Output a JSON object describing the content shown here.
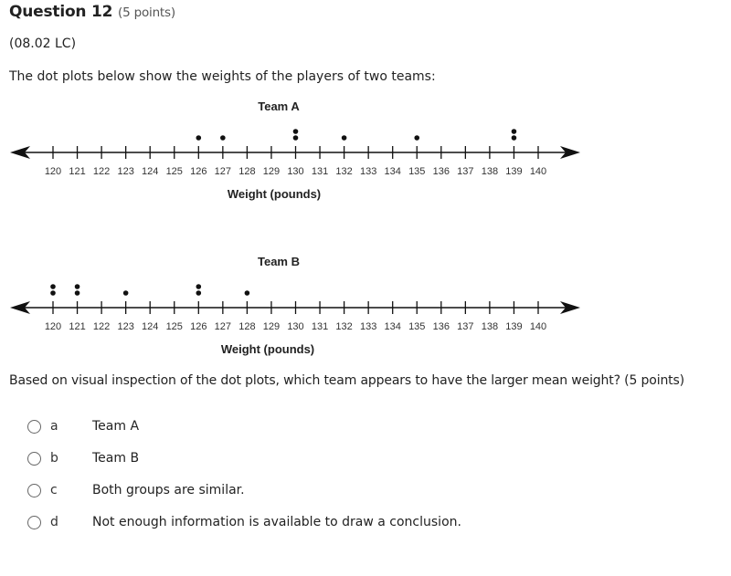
{
  "question": {
    "title": "Question 12",
    "points": "(5 points)",
    "code": "(08.02 LC)",
    "stem": "The dot plots below show the weights of the players of two teams:",
    "prompt": "Based on visual inspection of the dot plots, which team appears to have the larger mean weight? (5 points)"
  },
  "choices": [
    {
      "letter": "a",
      "text": "Team A"
    },
    {
      "letter": "b",
      "text": "Team B"
    },
    {
      "letter": "c",
      "text": "Both groups are similar."
    },
    {
      "letter": "d",
      "text": "Not enough information is available to draw a conclusion."
    }
  ],
  "chart_data": [
    {
      "type": "scatter",
      "subtype": "dot-plot",
      "title": "Team A",
      "xlabel": "Weight (pounds)",
      "ylabel": "",
      "xlim": [
        120,
        140
      ],
      "ticks": [
        120,
        121,
        122,
        123,
        124,
        125,
        126,
        127,
        128,
        129,
        130,
        131,
        132,
        133,
        134,
        135,
        136,
        137,
        138,
        139,
        140
      ],
      "points": [
        {
          "x": 126,
          "count": 1
        },
        {
          "x": 127,
          "count": 1
        },
        {
          "x": 130,
          "count": 2
        },
        {
          "x": 132,
          "count": 1
        },
        {
          "x": 135,
          "count": 1
        },
        {
          "x": 139,
          "count": 2
        }
      ]
    },
    {
      "type": "scatter",
      "subtype": "dot-plot",
      "title": "Team B",
      "xlabel": "Weight (pounds)",
      "ylabel": "",
      "xlim": [
        120,
        140
      ],
      "ticks": [
        120,
        121,
        122,
        123,
        124,
        125,
        126,
        127,
        128,
        129,
        130,
        131,
        132,
        133,
        134,
        135,
        136,
        137,
        138,
        139,
        140
      ],
      "points": [
        {
          "x": 120,
          "count": 2
        },
        {
          "x": 121,
          "count": 2
        },
        {
          "x": 123,
          "count": 1
        },
        {
          "x": 126,
          "count": 2
        },
        {
          "x": 128,
          "count": 1
        }
      ]
    }
  ]
}
